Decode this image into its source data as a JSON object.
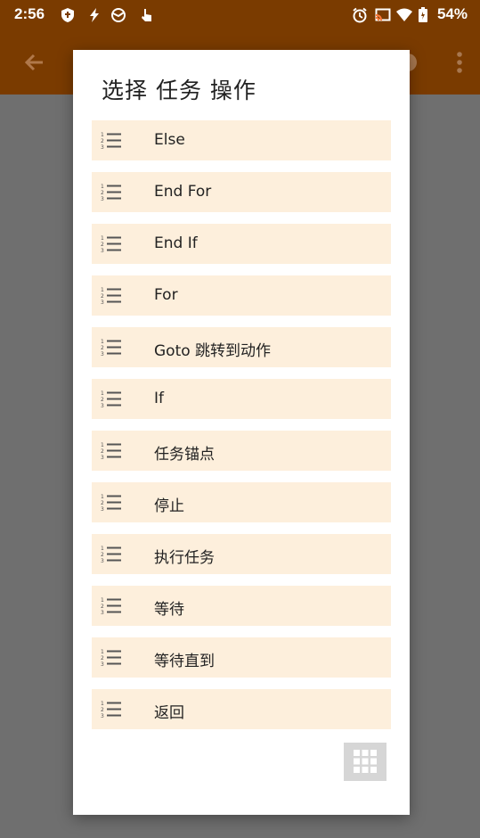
{
  "status_bar": {
    "time": "2:56",
    "battery": "54%",
    "icons": [
      "shield-icon",
      "flash-icon",
      "globe-icon",
      "tap-icon",
      "alarm-icon",
      "cast-icon",
      "wifi-icon",
      "battery-icon"
    ]
  },
  "app_bar": {
    "back_icon": "arrow-left-icon",
    "more_icon": "more-vert-icon"
  },
  "dialog": {
    "title": "选择 任务 操作",
    "items": [
      {
        "label": "Else",
        "icon": "numbered-list-icon"
      },
      {
        "label": "End For",
        "icon": "numbered-list-icon"
      },
      {
        "label": "End If",
        "icon": "numbered-list-icon"
      },
      {
        "label": "For",
        "icon": "numbered-list-icon"
      },
      {
        "label": "Goto 跳转到动作",
        "icon": "numbered-list-icon"
      },
      {
        "label": "If",
        "icon": "numbered-list-icon"
      },
      {
        "label": "任务锚点",
        "icon": "numbered-list-icon"
      },
      {
        "label": "停止",
        "icon": "numbered-list-icon"
      },
      {
        "label": "执行任务",
        "icon": "numbered-list-icon"
      },
      {
        "label": "等待",
        "icon": "numbered-list-icon"
      },
      {
        "label": "等待直到",
        "icon": "numbered-list-icon"
      },
      {
        "label": "返回",
        "icon": "numbered-list-icon"
      }
    ],
    "grid_button_icon": "grid-icon"
  },
  "colors": {
    "status_bar": "#7a3b00",
    "scrim": "#6f6f6f",
    "item_background": "#fdefdc",
    "grid_button": "#d6d6d6"
  }
}
